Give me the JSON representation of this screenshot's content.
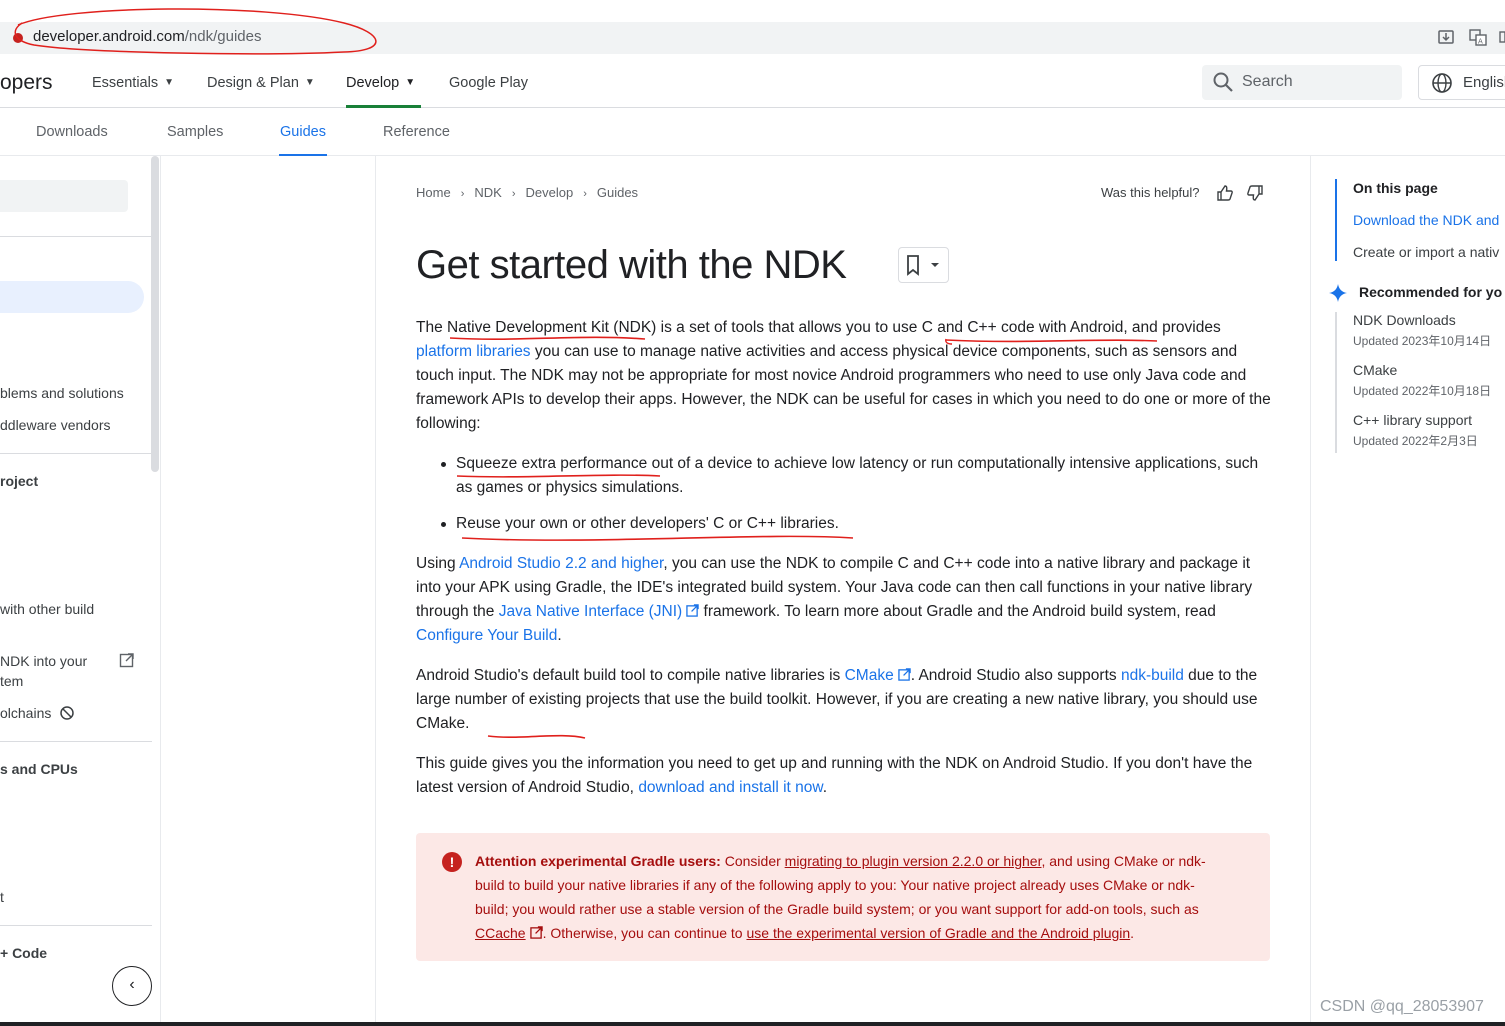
{
  "address_bar": {
    "host": "developer.android.com",
    "path": "/ndk/guides"
  },
  "topnav": {
    "brand": "opers",
    "items": [
      {
        "label": "Essentials"
      },
      {
        "label": "Design & Plan"
      },
      {
        "label": "Develop"
      },
      {
        "label": "Google Play"
      }
    ],
    "search_placeholder": "Search",
    "language": "English"
  },
  "subnav": {
    "items": [
      "Downloads",
      "Samples",
      "Guides",
      "Reference"
    ],
    "active": "Guides"
  },
  "sidebar": {
    "items": [
      {
        "label": "blems and solutions"
      },
      {
        "label": "ddleware vendors"
      },
      {
        "label": "roject"
      },
      {
        "label": "with other build"
      },
      {
        "label": "NDK into your"
      },
      {
        "label": "tem"
      },
      {
        "label": "olchains"
      },
      {
        "label": "s and CPUs"
      },
      {
        "label": "t"
      },
      {
        "label": "+ Code"
      }
    ]
  },
  "breadcrumb": [
    "Home",
    "NDK",
    "Develop",
    "Guides"
  ],
  "helpful_label": "Was this helpful?",
  "page_title": "Get started with the NDK",
  "content": {
    "p1_a": "The Native Development Kit (NDK) is a set of tools that allows you to use C and C++ code with Android, and provides ",
    "p1_link": "platform libraries",
    "p1_b": " you can use to manage native activities and access physical device components, such as sensors and touch input. The NDK may not be appropriate for most novice Android programmers who need to use only Java code and framework APIs to develop their apps. However, the NDK can be useful for cases in which you need to do one or more of the following:",
    "bullet1": "Squeeze extra performance out of a device to achieve low latency or run computationally intensive applications, such as games or physics simulations.",
    "bullet2": "Reuse your own or other developers' C or C++ libraries.",
    "p2_a": "Using ",
    "p2_link1": "Android Studio 2.2 and higher",
    "p2_b": ", you can use the NDK to compile C and C++ code into a native library and package it into your APK using Gradle, the IDE's integrated build system. Your Java code can then call functions in your native library through the ",
    "p2_link2": "Java Native Interface (JNI)",
    "p2_c": " framework. To learn more about Gradle and the Android build system, read ",
    "p2_link3": "Configure Your Build",
    "p2_d": ".",
    "p3_a": "Android Studio's default build tool to compile native libraries is ",
    "p3_link1": "CMake",
    "p3_b": ". Android Studio also supports ",
    "p3_link2": "ndk-build",
    "p3_c": " due to the large number of existing projects that use the build toolkit. However, if you are creating a new native library, you should use CMake.",
    "p4_a": "This guide gives you the information you need to get up and running with the NDK on Android Studio. If you don't have the latest version of Android Studio, ",
    "p4_link": "download and install it now",
    "p4_b": "."
  },
  "warning": {
    "bold": "Attention experimental Gradle users:",
    "t1": " Consider ",
    "link1": "migrating to plugin version 2.2.0 or higher",
    "t2": ", and using CMake or ndk-build to build your native libraries if any of the following apply to you: Your native project already uses CMake or ndk-build; you would rather use a stable version of the Gradle build system; or you want support for add-on tools, such as ",
    "link2": "CCache",
    "t3": ". Otherwise, you can continue to ",
    "link3": "use the experimental version of Gradle and the Android plugin",
    "t4": "."
  },
  "toc": {
    "heading": "On this page",
    "items": [
      "Download the NDK and",
      "Create or import a nativ"
    ],
    "recommended_heading": "Recommended for yo",
    "recommended": [
      {
        "title": "NDK Downloads",
        "updated": "Updated 2023年10月14日"
      },
      {
        "title": "CMake",
        "updated": "Updated 2022年10月18日"
      },
      {
        "title": "C++ library support",
        "updated": "Updated 2022年2月3日"
      }
    ]
  },
  "watermark": "CSDN @qq_28053907",
  "colors": {
    "link": "#1a73e8",
    "accent_underline": "#1a73e8",
    "warning_bg": "#fce8e6",
    "warning_text": "#a50e0e",
    "annotation_red": "#e0201c"
  }
}
